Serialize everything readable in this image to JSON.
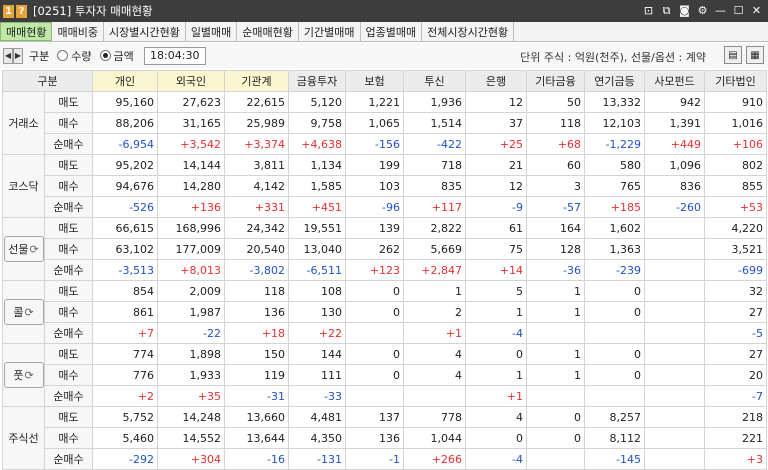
{
  "window": {
    "number": "1",
    "help": "?",
    "title": "[0251] 투자자 매매현황"
  },
  "tabs": [
    "매매현황",
    "매매비중",
    "시장별시간현황",
    "일별매매",
    "순매매현황",
    "기간별매매",
    "업종별매매",
    "전체시장시간현황"
  ],
  "toolbar": {
    "group_label": "구분",
    "radio_qty": "수량",
    "radio_amount": "금액",
    "time": "18:04:30",
    "unit_text": "단위 주식 : 억원(천주), 선물/옵션 : 계약"
  },
  "columns": [
    "구분",
    "개인",
    "외국인",
    "기관계",
    "금융투자",
    "보험",
    "투신",
    "은행",
    "기타금융",
    "연기금등",
    "사모펀드",
    "기타법인"
  ],
  "groups": [
    {
      "name": "거래소",
      "rows": [
        {
          "label": "매도",
          "values": [
            "95,160",
            "27,623",
            "22,615",
            "5,120",
            "1,221",
            "1,936",
            "12",
            "50",
            "13,332",
            "942",
            "910"
          ]
        },
        {
          "label": "매수",
          "values": [
            "88,206",
            "31,165",
            "25,989",
            "9,758",
            "1,065",
            "1,514",
            "37",
            "118",
            "12,103",
            "1,391",
            "1,016"
          ]
        },
        {
          "label": "순매수",
          "values": [
            "-6,954",
            "+3,542",
            "+3,374",
            "+4,638",
            "-156",
            "-422",
            "+25",
            "+68",
            "-1,229",
            "+449",
            "+106"
          ]
        }
      ]
    },
    {
      "name": "코스닥",
      "rows": [
        {
          "label": "매도",
          "values": [
            "95,202",
            "14,144",
            "3,811",
            "1,134",
            "199",
            "718",
            "21",
            "60",
            "580",
            "1,096",
            "802"
          ]
        },
        {
          "label": "매수",
          "values": [
            "94,676",
            "14,280",
            "4,142",
            "1,585",
            "103",
            "835",
            "12",
            "3",
            "765",
            "836",
            "855"
          ]
        },
        {
          "label": "순매수",
          "values": [
            "-526",
            "+136",
            "+331",
            "+451",
            "-96",
            "+117",
            "-9",
            "-57",
            "+185",
            "-260",
            "+53"
          ]
        }
      ]
    },
    {
      "name": "선물",
      "rows": [
        {
          "label": "매도",
          "values": [
            "66,615",
            "168,996",
            "24,342",
            "19,551",
            "139",
            "2,822",
            "61",
            "164",
            "1,602",
            "",
            "4,220"
          ]
        },
        {
          "label": "매수",
          "values": [
            "63,102",
            "177,009",
            "20,540",
            "13,040",
            "262",
            "5,669",
            "75",
            "128",
            "1,363",
            "",
            "3,521"
          ]
        },
        {
          "label": "순매수",
          "values": [
            "-3,513",
            "+8,013",
            "-3,802",
            "-6,511",
            "+123",
            "+2,847",
            "+14",
            "-36",
            "-239",
            "",
            "-699"
          ]
        }
      ]
    },
    {
      "name": "콜",
      "rows": [
        {
          "label": "매도",
          "values": [
            "854",
            "2,009",
            "118",
            "108",
            "0",
            "1",
            "5",
            "1",
            "0",
            "",
            "32"
          ]
        },
        {
          "label": "매수",
          "values": [
            "861",
            "1,987",
            "136",
            "130",
            "0",
            "2",
            "1",
            "1",
            "0",
            "",
            "27"
          ]
        },
        {
          "label": "순매수",
          "values": [
            "+7",
            "-22",
            "+18",
            "+22",
            "",
            "+1",
            "-4",
            "",
            "",
            "",
            "-5"
          ]
        }
      ]
    },
    {
      "name": "풋",
      "rows": [
        {
          "label": "매도",
          "values": [
            "774",
            "1,898",
            "150",
            "144",
            "0",
            "4",
            "0",
            "1",
            "0",
            "",
            "27"
          ]
        },
        {
          "label": "매수",
          "values": [
            "776",
            "1,933",
            "119",
            "111",
            "0",
            "4",
            "1",
            "1",
            "0",
            "",
            "20"
          ]
        },
        {
          "label": "순매수",
          "values": [
            "+2",
            "+35",
            "-31",
            "-33",
            "",
            "",
            "+1",
            "",
            "",
            "",
            "-7"
          ]
        }
      ]
    },
    {
      "name": "주식선",
      "rows": [
        {
          "label": "매도",
          "values": [
            "5,752",
            "14,248",
            "13,660",
            "4,481",
            "137",
            "778",
            "4",
            "0",
            "8,257",
            "",
            "218"
          ]
        },
        {
          "label": "매수",
          "values": [
            "5,460",
            "14,552",
            "13,644",
            "4,350",
            "136",
            "1,044",
            "0",
            "0",
            "8,112",
            "",
            "221"
          ]
        },
        {
          "label": "순매수",
          "values": [
            "-292",
            "+304",
            "-16",
            "-131",
            "-1",
            "+266",
            "-4",
            "",
            "-145",
            "",
            "+3"
          ]
        }
      ]
    }
  ],
  "colors": {
    "positive": "#e53030",
    "negative": "#2052c8",
    "active_tab": "#bfe8a8",
    "titlebar": "#3d3d3d",
    "highlight_header": "#fbf6cf"
  },
  "icons": {
    "group_box_cycle": "refresh-icon"
  }
}
